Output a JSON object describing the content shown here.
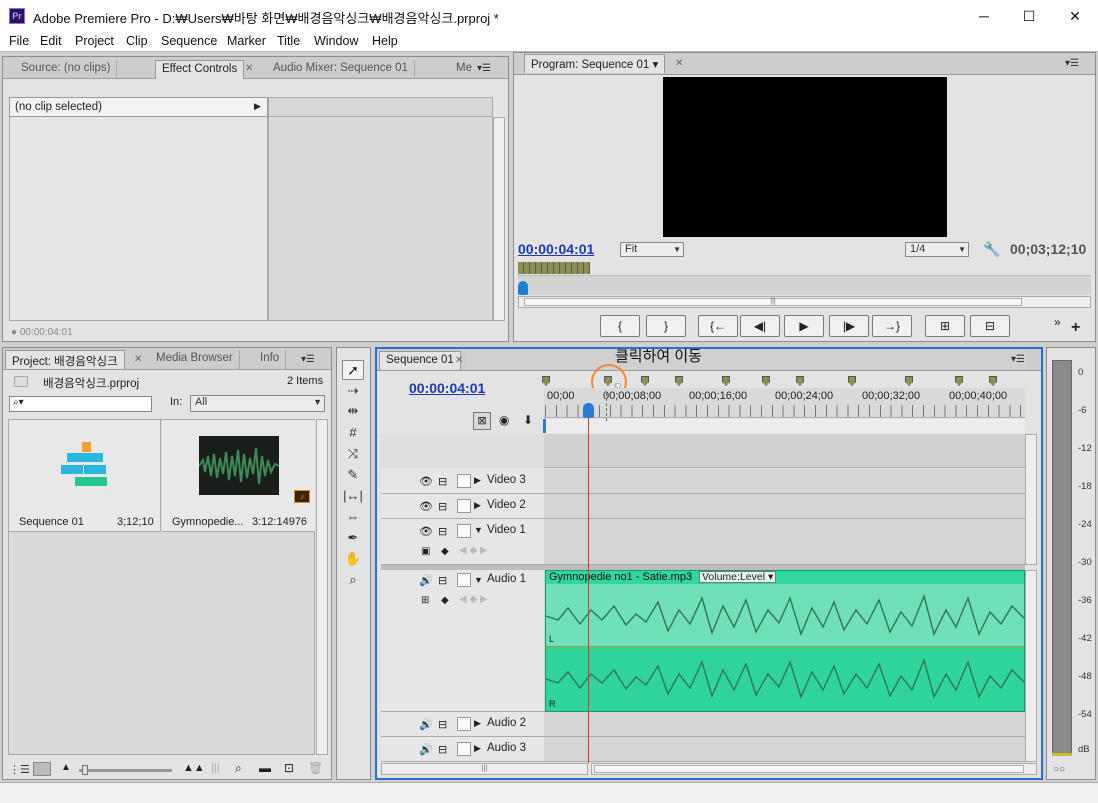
{
  "window": {
    "app_icon": "Pr",
    "title": "Adobe Premiere Pro - D:₩Users₩바탕 화면₩배경음악싱크₩배경음악싱크.prproj *",
    "minimize": "─",
    "maximize": "☐",
    "close": "✕"
  },
  "menu": [
    "File",
    "Edit",
    "Project",
    "Clip",
    "Sequence",
    "Marker",
    "Title",
    "Window",
    "Help"
  ],
  "source_panel": {
    "tabs": [
      "Source: (no clips)",
      "Effect Controls",
      "Audio Mixer: Sequence 01",
      "Me"
    ],
    "no_clip": "(no clip selected)",
    "timecode": "00:00:04:01"
  },
  "program": {
    "tab": "Program: Sequence 01",
    "timecode": "00:00:04:01",
    "fit": "Fit",
    "resolution": "1/4",
    "duration": "00;03;12;10",
    "buttons": [
      "{",
      "}",
      "{←",
      "◀|",
      "▶",
      "|▶",
      "→}",
      "⊞",
      "⊟"
    ]
  },
  "project": {
    "tabs": [
      "Project: 배경음악싱크",
      "Media Browser",
      "Info"
    ],
    "file": "배경음악싱크.prproj",
    "count": "2 Items",
    "in_label": "In:",
    "in_value": "All",
    "items": [
      {
        "name": "Sequence 01",
        "duration": "3;12;10"
      },
      {
        "name": "Gymnopedie...",
        "duration": "3:12:14976"
      }
    ]
  },
  "timeline": {
    "tab": "Sequence 01",
    "annotation": "클릭하여 이동",
    "timecode": "00:00:04:01",
    "ruler": [
      "00;00",
      "00;00;08;00",
      "00;00;16;00",
      "00;00;24;00",
      "00;00;32;00",
      "00;00;40;00"
    ],
    "tracks": {
      "v3": "Video 3",
      "v2": "Video 2",
      "v1": "Video 1",
      "a1": "Audio 1",
      "a2": "Audio 2",
      "a3": "Audio 3"
    },
    "clip_name": "Gymnopedie no1 - Satie.mp3",
    "clip_fx": "Volume:Level",
    "ch_l": "L",
    "ch_r": "R"
  },
  "meter": {
    "labels": [
      "0",
      "-6",
      "-12",
      "-18",
      "-24",
      "-30",
      "-36",
      "-42",
      "-48",
      "-54",
      "dB"
    ]
  },
  "colors": {
    "timecode": "#1d39b8",
    "clip": "#2fd49a",
    "playhead": "#d9342a",
    "marker": "#8d8e57"
  }
}
